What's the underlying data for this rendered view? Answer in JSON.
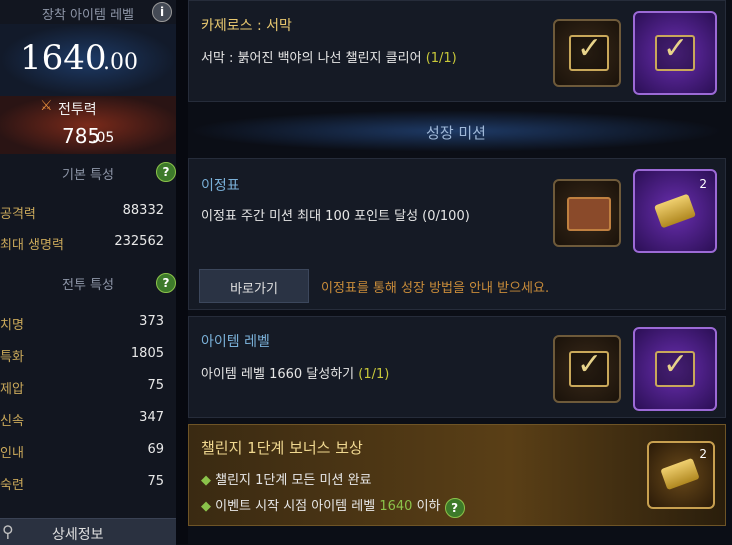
{
  "left": {
    "item_level_title": "장착 아이템 레벨",
    "item_level_int": "1640",
    "item_level_dec": ".00",
    "combat_label": "전투력",
    "combat_int": "785",
    "combat_dec": ".05",
    "basic_stats_title": "기본 특성",
    "basic_stats": [
      {
        "label": "공격력",
        "value": "88332"
      },
      {
        "label": "최대 생명력",
        "value": "232562"
      }
    ],
    "combat_stats_title": "전투 특성",
    "combat_stats": [
      {
        "label": "치명",
        "value": "373"
      },
      {
        "label": "특화",
        "value": "1805"
      },
      {
        "label": "제압",
        "value": "75"
      },
      {
        "label": "신속",
        "value": "347"
      },
      {
        "label": "인내",
        "value": "69"
      },
      {
        "label": "숙련",
        "value": "75"
      }
    ],
    "detail_button": "상세정보"
  },
  "main": {
    "card1": {
      "title": "카제로스 : 서막",
      "desc": "서막 : 붉어진 백야의 나선 챌린지 클리어",
      "progress": "(1/1)"
    },
    "section_title": "성장 미션",
    "card2": {
      "title": "이정표",
      "desc": "이정표 주간 미션 최대 100 포인트 달성 (0/100)",
      "button": "바로가기",
      "hint": "이정표를 통해 성장 방법을 안내 받으세요.",
      "reward_count": "2"
    },
    "card3": {
      "title": "아이템 레벨",
      "desc": "아이템 레벨 1660 달성하기",
      "progress": "(1/1)"
    },
    "bonus": {
      "title": "챌린지 1단계 보너스 보상",
      "line1": "챌린지 1단계 모든 미션 완료",
      "line2_pre": "이벤트 시작 시점 아이템 레벨",
      "line2_level": "1640",
      "line2_post": "이하",
      "reward_count": "2"
    }
  },
  "colors": {
    "gold": "#c9a85a",
    "accent_blue": "#7ab0d8",
    "yellow": "#c8c83a",
    "green": "#8bc34a"
  }
}
